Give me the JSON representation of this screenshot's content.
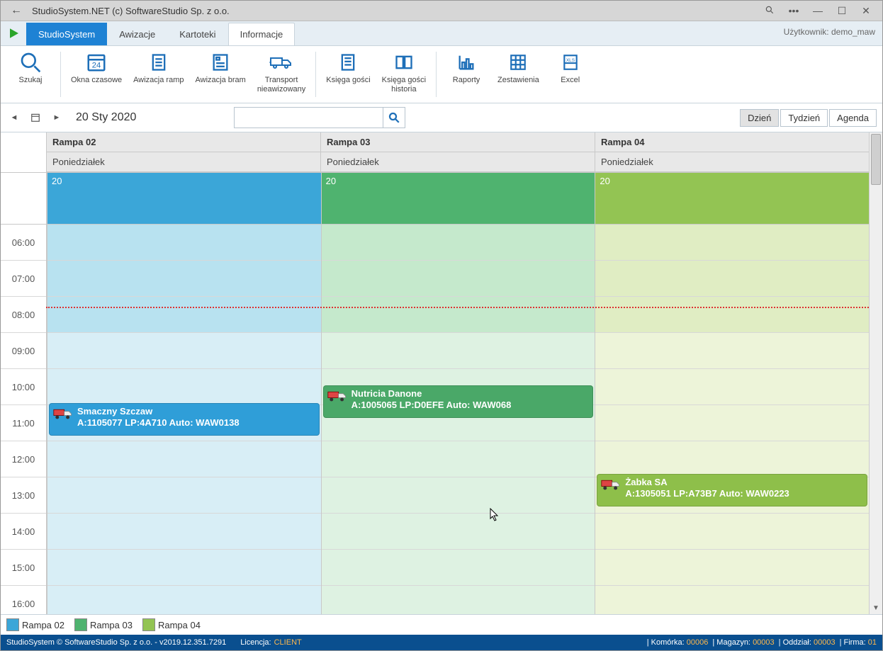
{
  "window": {
    "title": "StudioSystem.NET (c) SoftwareStudio Sp. z o.o."
  },
  "user": {
    "label": "Użytkownik: demo_maw"
  },
  "tabs": {
    "primary": "StudioSystem",
    "t1": "Awizacje",
    "t2": "Kartoteki",
    "t3": "Informacje"
  },
  "ribbon": {
    "search": "Szukaj",
    "windows": "Okna czasowe",
    "ramp": "Awizacja ramp",
    "gate": "Awizacja bram",
    "transport": "Transport\nnieawizowany",
    "guest": "Księga gości",
    "guesthist": "Księga gości\nhistoria",
    "reports": "Raporty",
    "lists": "Zestawienia",
    "excel": "Excel"
  },
  "date": {
    "label": "20 Sty 2020"
  },
  "views": {
    "day": "Dzień",
    "week": "Tydzień",
    "agenda": "Agenda"
  },
  "columns": [
    {
      "name": "Rampa 02",
      "day": "Poniedziałek",
      "daynum": "20",
      "bg": "#3ba6d8",
      "light": "#d8eef6",
      "stripe": "#b8e2f0"
    },
    {
      "name": "Rampa 03",
      "day": "Poniedziałek",
      "daynum": "20",
      "bg": "#4fb36f",
      "light": "#def2e2",
      "stripe": "#c5e9cc"
    },
    {
      "name": "Rampa 04",
      "day": "Poniedziałek",
      "daynum": "20",
      "bg": "#93c453",
      "light": "#edf4d9",
      "stripe": "#e0edc3"
    }
  ],
  "hours": [
    "06:00",
    "07:00",
    "08:00",
    "09:00",
    "10:00",
    "11:00",
    "12:00",
    "13:00",
    "14:00",
    "15:00",
    "16:00"
  ],
  "appointments": [
    {
      "col": 0,
      "slot": 5,
      "title": "Smaczny Szczaw",
      "detail": "A:1105077 LP:4A710 Auto: WAW0138",
      "color": "#2f9ed8"
    },
    {
      "col": 1,
      "slot": 4.5,
      "title": "Nutricia Danone",
      "detail": "A:1005065 LP:D0EFE Auto: WAW068",
      "color": "#4aa868"
    },
    {
      "col": 2,
      "slot": 7,
      "title": "Żabka SA",
      "detail": "A:1305051 LP:A73B7 Auto: WAW0223",
      "color": "#8ebf4a"
    }
  ],
  "legend": [
    {
      "label": "Rampa 02",
      "color": "#3ba6d8"
    },
    {
      "label": "Rampa 03",
      "color": "#4fb36f"
    },
    {
      "label": "Rampa 04",
      "color": "#93c453"
    }
  ],
  "status": {
    "copy": "StudioSystem © SoftwareStudio Sp. z o.o. - v2019.12.351.7291",
    "licLabel": "Licencja:",
    "lic": "CLIENT",
    "cell": "Komórka:",
    "cellv": "00006",
    "wh": "Magazyn:",
    "whv": "00003",
    "dep": "Oddział:",
    "depv": "00003",
    "firm": "Firma:",
    "firmv": "01"
  },
  "search": {
    "placeholder": ""
  },
  "nowline_percent": 21
}
